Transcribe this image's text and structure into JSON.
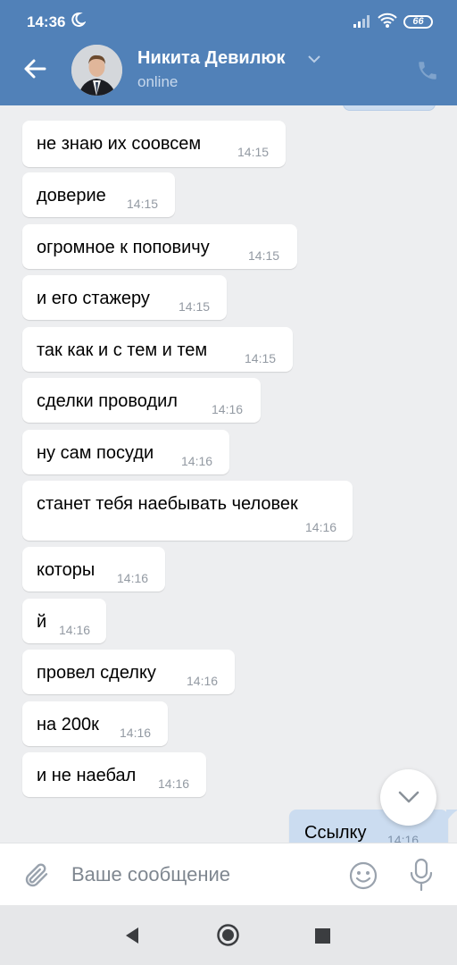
{
  "status_bar": {
    "time": "14:36",
    "battery": "66"
  },
  "header": {
    "name": "Никита Девилюк",
    "status": "online"
  },
  "messages": [
    {
      "text": "не знаю их соовсем",
      "time": "14:15"
    },
    {
      "text": "доверие",
      "time": "14:15"
    },
    {
      "text": "огромное к поповичу",
      "time": "14:15"
    },
    {
      "text": "и его стажеру",
      "time": "14:15"
    },
    {
      "text": "так как и с тем и тем",
      "time": "14:15"
    },
    {
      "text": "сделки проводил",
      "time": "14:16"
    },
    {
      "text": "ну сам посуди",
      "time": "14:16"
    },
    {
      "text": "станет тебя наебывать человек",
      "time": "14:16"
    },
    {
      "text": "которы",
      "time": "14:16"
    },
    {
      "text": "й",
      "time": "14:16"
    },
    {
      "text": "провел сделку",
      "time": "14:16"
    },
    {
      "text": "на 200к",
      "time": "14:16"
    },
    {
      "text": "и не наебал",
      "time": "14:16"
    }
  ],
  "outgoing": {
    "text": "Ссылку",
    "time": "14:16"
  },
  "composer": {
    "placeholder": "Ваше сообщение"
  },
  "colors": {
    "header": "#5181b8",
    "outgoing_bubble": "#cbdcf0",
    "background": "#edeef0"
  }
}
